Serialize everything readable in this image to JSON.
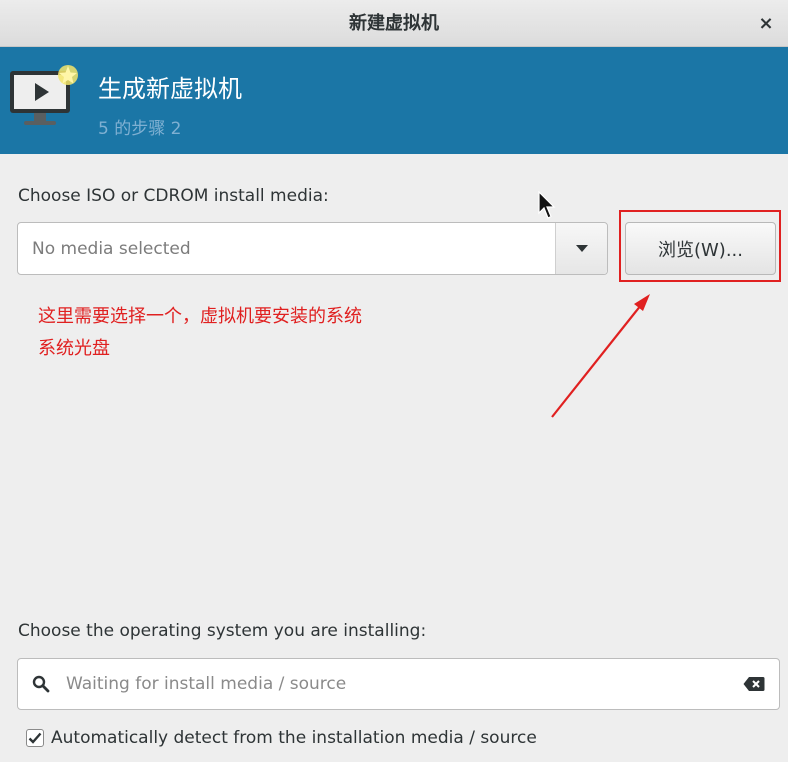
{
  "window": {
    "title": "新建虚拟机",
    "close_symbol": "×"
  },
  "header": {
    "icon": "vm-monitor-new-icon",
    "title": "生成新虚拟机",
    "step": "5 的步骤 2",
    "background": "#1b76a6"
  },
  "media": {
    "label": "Choose ISO or CDROM install media:",
    "placeholder": "No media selected",
    "browse_label": "浏览(W)..."
  },
  "annotation": {
    "line1": "这里需要选择一个，虚拟机要安装的系统",
    "line2": "系统光盘",
    "color": "#e02020"
  },
  "os": {
    "label": "Choose the operating system you are installing:",
    "search_placeholder": "Waiting for install media / source",
    "auto_detect_label": "Automatically detect from the installation media / source",
    "auto_detect_checked": true
  }
}
